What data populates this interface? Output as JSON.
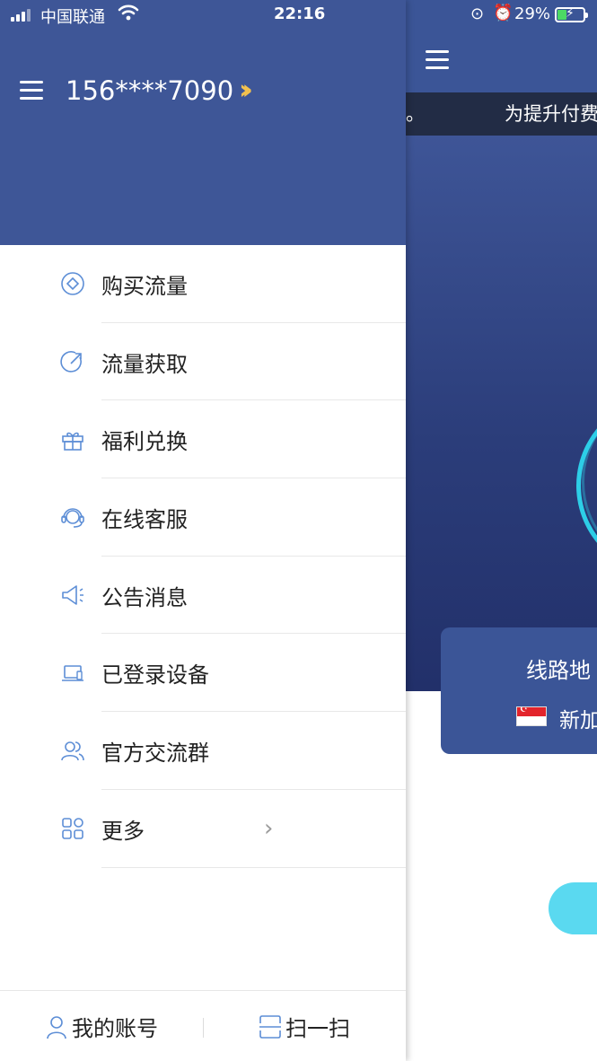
{
  "status_bar": {
    "carrier": "中国联通",
    "time": "22:16",
    "battery": "29%"
  },
  "main_screen": {
    "notice_tail": "。",
    "notice_text": "为提升付费",
    "route_title": "线路地",
    "route_name": "新加"
  },
  "drawer": {
    "account": "156****7090",
    "menu": [
      {
        "label": "购买流量",
        "icon": "coin-icon"
      },
      {
        "label": "流量获取",
        "icon": "share-arrow-icon"
      },
      {
        "label": "福利兑换",
        "icon": "gift-icon"
      },
      {
        "label": "在线客服",
        "icon": "headset-icon"
      },
      {
        "label": "公告消息",
        "icon": "megaphone-icon"
      },
      {
        "label": "已登录设备",
        "icon": "laptop-icon"
      },
      {
        "label": "官方交流群",
        "icon": "group-icon"
      },
      {
        "label": "更多",
        "icon": "grid-icon"
      }
    ],
    "bottom": {
      "my_account": "我的账号",
      "scan": "扫一扫"
    }
  },
  "colors": {
    "header_blue": "#3e5697",
    "icon_blue": "#5d8ed6",
    "accent_gold": "#f2c14e",
    "cyan": "#5ad9f0"
  }
}
